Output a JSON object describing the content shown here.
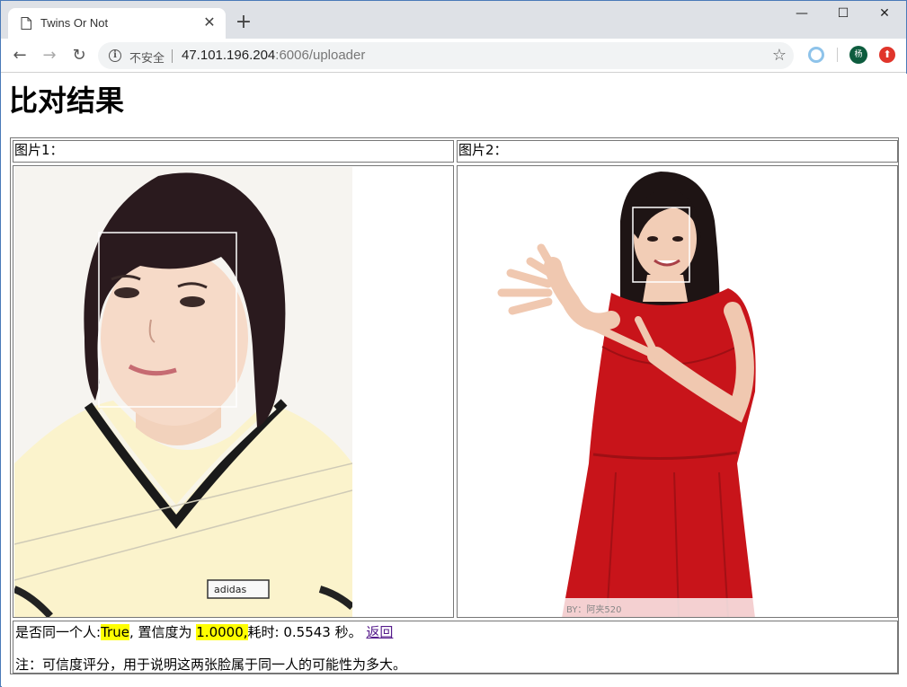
{
  "browser": {
    "tab_title": "Twins Or Not",
    "security_label": "不安全",
    "url_host": "47.101.196.204",
    "url_rest": ":6006/uploader",
    "avatar_text": "杨"
  },
  "page": {
    "heading": "比对结果",
    "image1_label": "图片1：",
    "image2_label": "图片2：",
    "result": {
      "prefix": "是否同一个人:",
      "is_same": "True",
      "confidence_label": ", 置信度为",
      "confidence": "1.0000,",
      "time_label": "耗时: 0.5543 秒。",
      "back_link": "返回"
    },
    "note": "注：可信度评分，用于说明这两张脸属于同一人的可能性为多大。",
    "image2_watermark": "BY：阿夹520"
  },
  "colors": {
    "highlight": "#ffff00",
    "link": "#551a8b",
    "dress": "#c8141a"
  },
  "icons": [
    "page-icon",
    "close-icon",
    "plus-icon",
    "minimize-icon",
    "maximize-icon",
    "window-close-icon",
    "back-arrow-icon",
    "forward-arrow-icon",
    "reload-icon",
    "info-icon",
    "star-icon",
    "extension-icon"
  ]
}
